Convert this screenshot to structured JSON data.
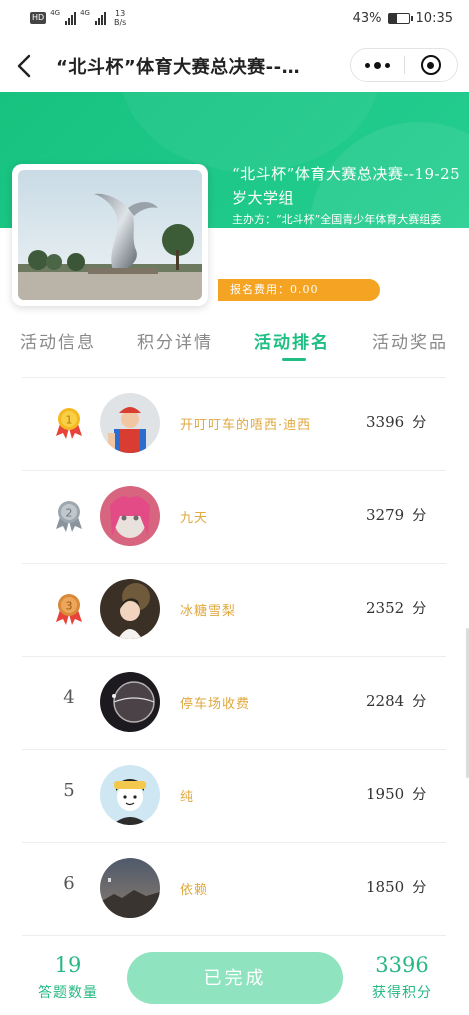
{
  "status_bar": {
    "hd_label": "HD",
    "signal_1_tag": "4G",
    "signal_2_tag": "4G",
    "net_speed_value": "13",
    "net_speed_unit": "B/s",
    "battery_percent": "43%",
    "battery_level": 0.43,
    "time": "10:35"
  },
  "nav": {
    "title": "“北斗杯”体育大赛总决赛--…",
    "back_icon": "chevron-left-icon",
    "more_icon": "more-dots-icon",
    "close_icon": "target-circle-icon"
  },
  "event": {
    "title": "“北斗杯”体育大赛总决赛--19-25岁大学组",
    "organizer": "主办方：“北斗杯”全国青少年体育大赛组委会",
    "fee": "报名费用：0.00"
  },
  "tabs": [
    {
      "label": "活动信息",
      "active": false
    },
    {
      "label": "积分详情",
      "active": false
    },
    {
      "label": "活动排名",
      "active": true
    },
    {
      "label": "活动奖品",
      "active": false
    }
  ],
  "ranking": [
    {
      "rank": "1",
      "medal": "gold-medal-icon",
      "name": "开叮叮车的唔西·迪西",
      "score": "3396",
      "unit": "分"
    },
    {
      "rank": "2",
      "medal": "silver-medal-icon",
      "name": "九天",
      "score": "3279",
      "unit": "分"
    },
    {
      "rank": "3",
      "medal": "bronze-medal-icon",
      "name": "冰糖雪梨",
      "score": "2352",
      "unit": "分"
    },
    {
      "rank": "4",
      "medal": "",
      "name": "停车场收费",
      "score": "2284",
      "unit": "分"
    },
    {
      "rank": "5",
      "medal": "",
      "name": "纯",
      "score": "1950",
      "unit": "分"
    },
    {
      "rank": "6",
      "medal": "",
      "name": "依赖",
      "score": "1850",
      "unit": "分"
    }
  ],
  "footer": {
    "answered_count": "19",
    "answered_label": "答题数量",
    "button_label": "已完成",
    "points_value": "3396",
    "points_label": "获得积分"
  },
  "colors": {
    "brand_green": "#1fbf84",
    "fee_orange": "#f5a323",
    "name_gold": "#e0a83e",
    "button_green": "#8fe3bf"
  }
}
